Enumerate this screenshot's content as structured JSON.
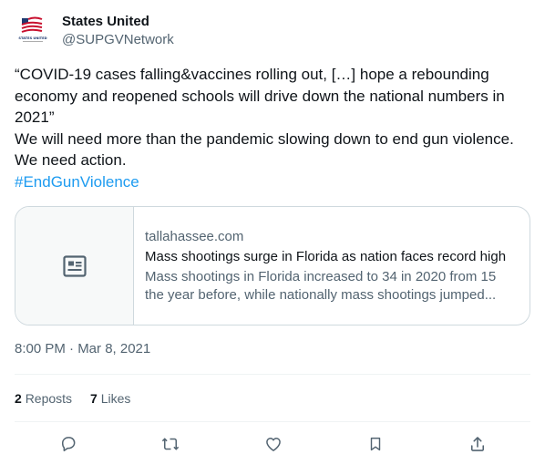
{
  "account": {
    "display_name": "States United",
    "handle": "@SUPGVNetwork",
    "avatar_caption": "STATES UNITED"
  },
  "tweet": {
    "lines": [
      "“COVID-19 cases falling&vaccines rolling out, […] hope a rebounding",
      "economy and reopened schools will drive down the national numbers in",
      "2021”",
      "We will need more than the pandemic slowing down to end gun violence.",
      "We need action."
    ],
    "hashtag": "#EndGunViolence"
  },
  "card": {
    "domain": "tallahassee.com",
    "title": "Mass shootings surge in Florida as nation faces record high",
    "description_lines": [
      "Mass shootings in Florida increased to 34 in 2020 from 15",
      "the year before, while nationally mass shootings jumped..."
    ],
    "thumbnail_icon": "article-icon"
  },
  "timestamp": "8:00 PM · Mar 8, 2021",
  "stats": {
    "reposts_count": "2",
    "reposts_label": "Reposts",
    "likes_count": "7",
    "likes_label": "Likes"
  },
  "actions": [
    "reply-icon",
    "repost-icon",
    "like-icon",
    "bookmark-icon",
    "share-icon"
  ],
  "colors": {
    "text": "#0f1419",
    "secondary": "#536471",
    "link": "#1d9bf0",
    "border": "#cfd9de"
  }
}
